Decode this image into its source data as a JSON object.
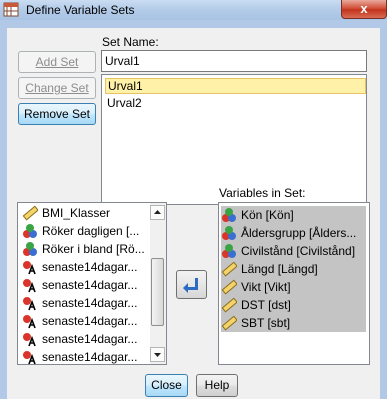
{
  "window": {
    "title": "Define Variable Sets",
    "close_glyph": "x"
  },
  "buttons": {
    "add_set": "Add Set",
    "change_set": "Change Set",
    "remove_set": "Remove Set",
    "close": "Close",
    "help": "Help"
  },
  "set_name": {
    "label": "Set Name:",
    "value": "Urval1"
  },
  "sets": [
    {
      "name": "Urval1",
      "selected": true
    },
    {
      "name": "Urval2",
      "selected": false
    }
  ],
  "available_variables": [
    {
      "name": "BMI_Klasser",
      "icon": "scale-ruler-icon"
    },
    {
      "name": "Röker dagligen [...",
      "icon": "nominal-icon"
    },
    {
      "name": "Röker i bland [Rö...",
      "icon": "nominal-icon"
    },
    {
      "name": "senaste14dagar...",
      "icon": "string-icon"
    },
    {
      "name": "senaste14dagar...",
      "icon": "string-icon"
    },
    {
      "name": "senaste14dagar...",
      "icon": "string-icon"
    },
    {
      "name": "senaste14dagar...",
      "icon": "string-icon"
    },
    {
      "name": "senaste14dagar...",
      "icon": "string-icon"
    },
    {
      "name": "senaste14dagar...",
      "icon": "string-icon"
    }
  ],
  "variables_in_set": {
    "label": "Variables in Set:",
    "items": [
      {
        "name": "Kön [Kön]",
        "icon": "nominal-icon"
      },
      {
        "name": "Åldersgrupp [Ålders...",
        "icon": "nominal-icon"
      },
      {
        "name": "Civilstånd [Civilstånd]",
        "icon": "nominal-icon"
      },
      {
        "name": "Längd [Längd]",
        "icon": "scale-ruler-icon"
      },
      {
        "name": "Vikt [Vikt]",
        "icon": "scale-ruler-icon"
      },
      {
        "name": "DST [dst]",
        "icon": "scale-ruler-icon"
      },
      {
        "name": "SBT [sbt]",
        "icon": "scale-ruler-icon"
      }
    ]
  },
  "colors": {
    "selected_set_bg": "#fff2a8",
    "selected_vars_bg": "#c4c4c4",
    "move_arrow": "#2d6bc2"
  }
}
